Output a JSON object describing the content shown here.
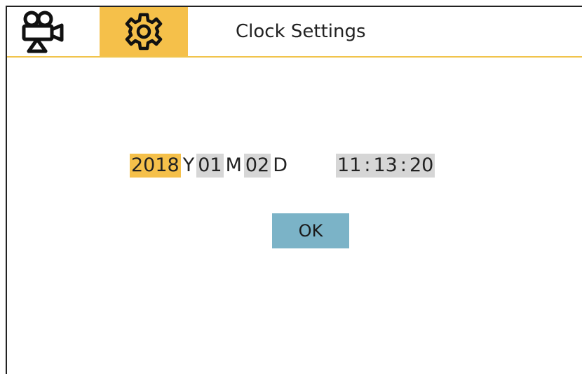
{
  "header": {
    "tabs": [
      {
        "id": "camera",
        "icon": "movie-camera-icon",
        "selected": false
      },
      {
        "id": "settings",
        "icon": "gear-icon",
        "selected": true
      }
    ],
    "title": "Clock Settings"
  },
  "clock": {
    "year": "2018",
    "year_unit": "Y",
    "month": "01",
    "month_unit": "M",
    "day": "02",
    "day_unit": "D",
    "hour": "11",
    "minute": "13",
    "second": "20",
    "time_separator": ":",
    "active_field": "year"
  },
  "actions": {
    "ok_label": "OK"
  },
  "colors": {
    "accent": "#f5c04a",
    "field_bg": "#d6d6d6",
    "ok_bg": "#7bb3c7",
    "divider": "#f1c44c"
  }
}
